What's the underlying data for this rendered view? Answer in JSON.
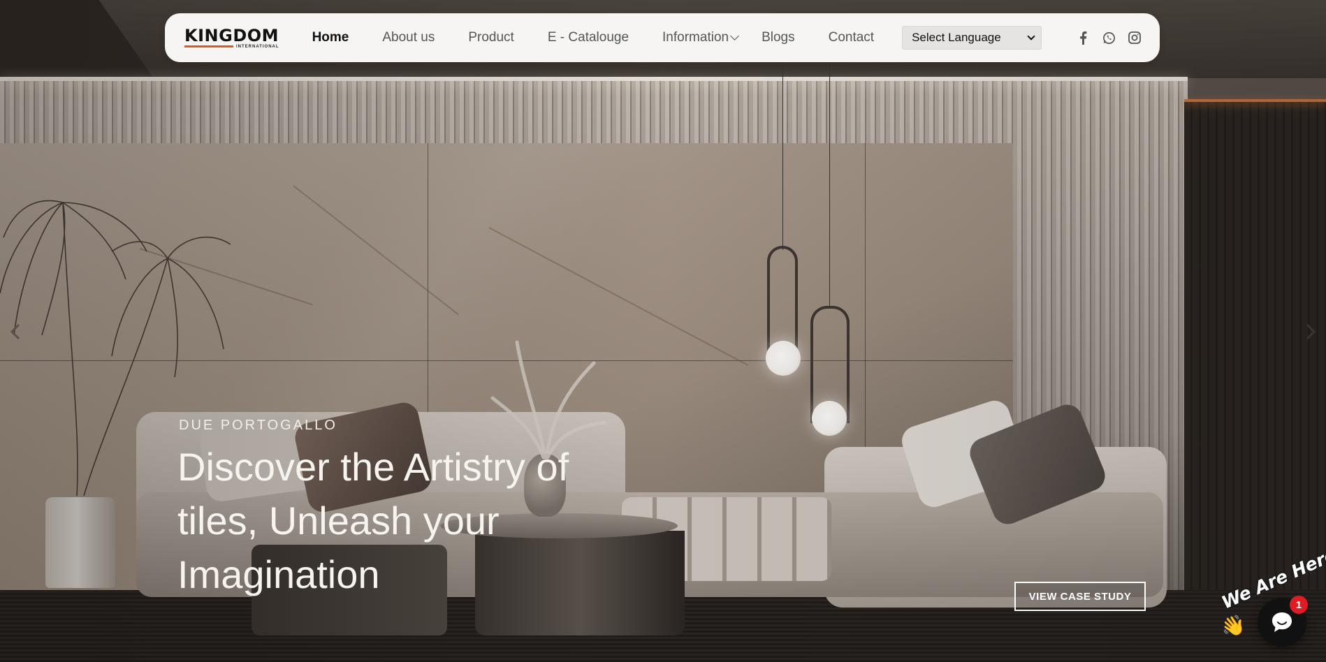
{
  "nav": {
    "logo_text": "KINGDOM",
    "logo_subtext": "INTERNATIONAL",
    "links": [
      {
        "label": "Home",
        "active": true
      },
      {
        "label": "About us"
      },
      {
        "label": "Product"
      },
      {
        "label": "E - Catalouge"
      },
      {
        "label": "Information",
        "has_dropdown": true
      },
      {
        "label": "Blogs"
      },
      {
        "label": "Contact"
      }
    ],
    "language_select": {
      "selected": "Select Language"
    },
    "socials": [
      "facebook-icon",
      "whatsapp-icon",
      "instagram-icon"
    ],
    "accent_color": "#e05a1c"
  },
  "hero": {
    "eyebrow": "DUE PORTOGALLO",
    "headline": "Discover the Artistry of tiles, Unleash your Imagination",
    "cta_label": "VIEW CASE STUDY"
  },
  "carousel": {
    "prev_icon": "chevron-left-icon",
    "next_icon": "chevron-right-icon"
  },
  "chat_widget": {
    "badge_text": "We Are Here!",
    "unread_count": "1",
    "icon": "chat-bubble-icon",
    "badge_color": "#e01b24"
  }
}
